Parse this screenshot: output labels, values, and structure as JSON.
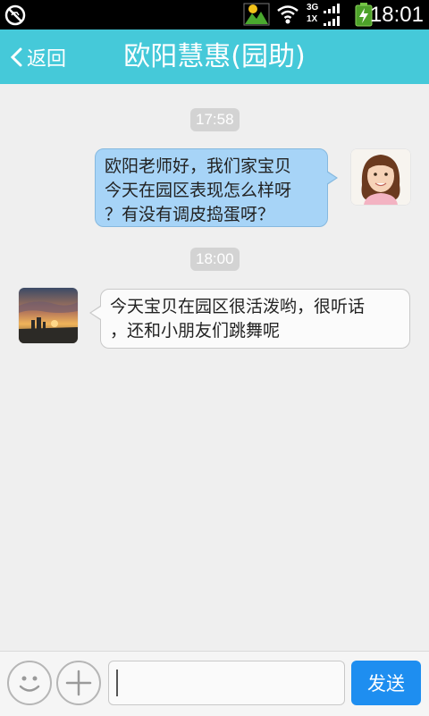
{
  "status_bar": {
    "time": "18:01",
    "network_3g": "3G",
    "network_1x": "1X",
    "icons": [
      "silent-icon",
      "gallery-icon",
      "wifi-icon",
      "signal-icon",
      "battery-charging-icon"
    ]
  },
  "header": {
    "back_label": "返回",
    "title": "欧阳慧惠(园助)"
  },
  "messages": [
    {
      "type": "timestamp",
      "text": "17:58"
    },
    {
      "type": "outgoing",
      "line1": "欧阳老师好，我们家宝贝",
      "line2": "今天在园区表现怎么样呀",
      "line3": "？有没有调皮捣蛋呀？"
    },
    {
      "type": "timestamp",
      "text": "18:00"
    },
    {
      "type": "incoming",
      "line1": "今天宝贝在园区很活泼哟，很听话",
      "line2": "，还和小朋友们跳舞呢"
    }
  ],
  "input": {
    "placeholder": "",
    "send_label": "发送"
  },
  "colors": {
    "title_bar": "#45c9d9",
    "outgoing_bubble": "#a7d4f7",
    "incoming_bubble": "#fbfbfb",
    "send_button": "#1e8ef0"
  }
}
